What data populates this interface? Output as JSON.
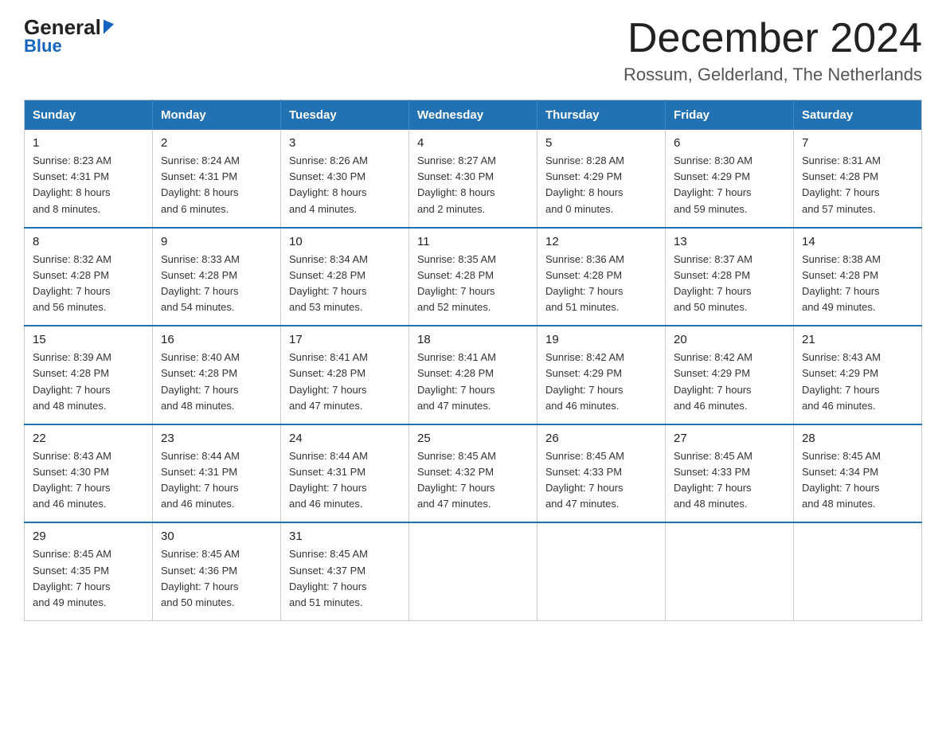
{
  "logo": {
    "line1_black": "General",
    "line1_blue_arrow": "▶",
    "line2": "Blue"
  },
  "header": {
    "month_title": "December 2024",
    "subtitle": "Rossum, Gelderland, The Netherlands"
  },
  "days_of_week": [
    "Sunday",
    "Monday",
    "Tuesday",
    "Wednesday",
    "Thursday",
    "Friday",
    "Saturday"
  ],
  "weeks": [
    [
      {
        "day": "1",
        "sunrise": "8:23 AM",
        "sunset": "4:31 PM",
        "daylight": "8 hours and 8 minutes."
      },
      {
        "day": "2",
        "sunrise": "8:24 AM",
        "sunset": "4:31 PM",
        "daylight": "8 hours and 6 minutes."
      },
      {
        "day": "3",
        "sunrise": "8:26 AM",
        "sunset": "4:30 PM",
        "daylight": "8 hours and 4 minutes."
      },
      {
        "day": "4",
        "sunrise": "8:27 AM",
        "sunset": "4:30 PM",
        "daylight": "8 hours and 2 minutes."
      },
      {
        "day": "5",
        "sunrise": "8:28 AM",
        "sunset": "4:29 PM",
        "daylight": "8 hours and 0 minutes."
      },
      {
        "day": "6",
        "sunrise": "8:30 AM",
        "sunset": "4:29 PM",
        "daylight": "7 hours and 59 minutes."
      },
      {
        "day": "7",
        "sunrise": "8:31 AM",
        "sunset": "4:28 PM",
        "daylight": "7 hours and 57 minutes."
      }
    ],
    [
      {
        "day": "8",
        "sunrise": "8:32 AM",
        "sunset": "4:28 PM",
        "daylight": "7 hours and 56 minutes."
      },
      {
        "day": "9",
        "sunrise": "8:33 AM",
        "sunset": "4:28 PM",
        "daylight": "7 hours and 54 minutes."
      },
      {
        "day": "10",
        "sunrise": "8:34 AM",
        "sunset": "4:28 PM",
        "daylight": "7 hours and 53 minutes."
      },
      {
        "day": "11",
        "sunrise": "8:35 AM",
        "sunset": "4:28 PM",
        "daylight": "7 hours and 52 minutes."
      },
      {
        "day": "12",
        "sunrise": "8:36 AM",
        "sunset": "4:28 PM",
        "daylight": "7 hours and 51 minutes."
      },
      {
        "day": "13",
        "sunrise": "8:37 AM",
        "sunset": "4:28 PM",
        "daylight": "7 hours and 50 minutes."
      },
      {
        "day": "14",
        "sunrise": "8:38 AM",
        "sunset": "4:28 PM",
        "daylight": "7 hours and 49 minutes."
      }
    ],
    [
      {
        "day": "15",
        "sunrise": "8:39 AM",
        "sunset": "4:28 PM",
        "daylight": "7 hours and 48 minutes."
      },
      {
        "day": "16",
        "sunrise": "8:40 AM",
        "sunset": "4:28 PM",
        "daylight": "7 hours and 48 minutes."
      },
      {
        "day": "17",
        "sunrise": "8:41 AM",
        "sunset": "4:28 PM",
        "daylight": "7 hours and 47 minutes."
      },
      {
        "day": "18",
        "sunrise": "8:41 AM",
        "sunset": "4:28 PM",
        "daylight": "7 hours and 47 minutes."
      },
      {
        "day": "19",
        "sunrise": "8:42 AM",
        "sunset": "4:29 PM",
        "daylight": "7 hours and 46 minutes."
      },
      {
        "day": "20",
        "sunrise": "8:42 AM",
        "sunset": "4:29 PM",
        "daylight": "7 hours and 46 minutes."
      },
      {
        "day": "21",
        "sunrise": "8:43 AM",
        "sunset": "4:29 PM",
        "daylight": "7 hours and 46 minutes."
      }
    ],
    [
      {
        "day": "22",
        "sunrise": "8:43 AM",
        "sunset": "4:30 PM",
        "daylight": "7 hours and 46 minutes."
      },
      {
        "day": "23",
        "sunrise": "8:44 AM",
        "sunset": "4:31 PM",
        "daylight": "7 hours and 46 minutes."
      },
      {
        "day": "24",
        "sunrise": "8:44 AM",
        "sunset": "4:31 PM",
        "daylight": "7 hours and 46 minutes."
      },
      {
        "day": "25",
        "sunrise": "8:45 AM",
        "sunset": "4:32 PM",
        "daylight": "7 hours and 47 minutes."
      },
      {
        "day": "26",
        "sunrise": "8:45 AM",
        "sunset": "4:33 PM",
        "daylight": "7 hours and 47 minutes."
      },
      {
        "day": "27",
        "sunrise": "8:45 AM",
        "sunset": "4:33 PM",
        "daylight": "7 hours and 48 minutes."
      },
      {
        "day": "28",
        "sunrise": "8:45 AM",
        "sunset": "4:34 PM",
        "daylight": "7 hours and 48 minutes."
      }
    ],
    [
      {
        "day": "29",
        "sunrise": "8:45 AM",
        "sunset": "4:35 PM",
        "daylight": "7 hours and 49 minutes."
      },
      {
        "day": "30",
        "sunrise": "8:45 AM",
        "sunset": "4:36 PM",
        "daylight": "7 hours and 50 minutes."
      },
      {
        "day": "31",
        "sunrise": "8:45 AM",
        "sunset": "4:37 PM",
        "daylight": "7 hours and 51 minutes."
      },
      null,
      null,
      null,
      null
    ]
  ],
  "labels": {
    "sunrise": "Sunrise:",
    "sunset": "Sunset:",
    "daylight": "Daylight:"
  }
}
